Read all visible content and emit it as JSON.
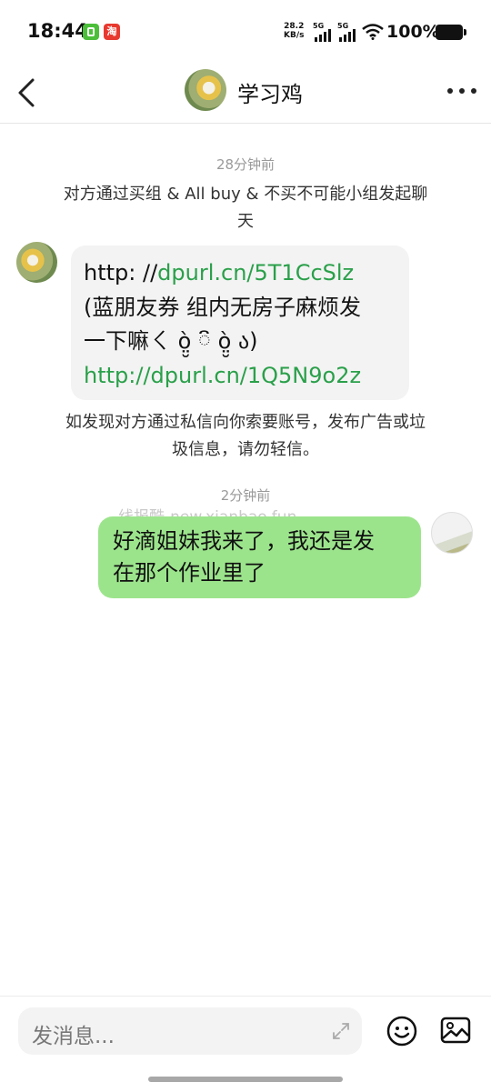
{
  "status_bar": {
    "time": "18:44",
    "notification_badge": "淘",
    "net_speed_value": "28.2",
    "net_speed_unit": "KB/s",
    "signal_1": "5G",
    "signal_2": "5G",
    "battery": "100%"
  },
  "header": {
    "title": "学习鸡",
    "back_icon": "chevron-left-icon",
    "more_icon": "more-horizontal-icon"
  },
  "chat": {
    "timestamp_1": "28分钟前",
    "system_intro_line1": "对方通过买组 & All buy & 不买不可能小组发起聊",
    "system_intro_line2": "天",
    "incoming_message": {
      "line1_prefix": "http: //",
      "line1_link": "dpurl.cn/5T1CcSlz",
      "line2": "(蓝朋友券 组内无房子麻烦发",
      "line3": "一下嘛ㄑ ὸ̤̮ ៝ ὸ̤̮ ა)",
      "line4_link": "http://dpurl.cn/1Q5N9o2z"
    },
    "system_warning_line1": "如发现对方通过私信向你索要账号，发布广告或垃",
    "system_warning_line2": "圾信息，请勿轻信。",
    "timestamp_2": "2分钟前",
    "watermark": "线报酷-new.xianbao.fun",
    "outgoing_message": {
      "line1": "好滴姐妹我来了，我还是发",
      "line2": "在那个作业里了"
    }
  },
  "input_bar": {
    "placeholder": "发消息...",
    "expand_icon": "expand-icon",
    "emoji_icon": "smiley-icon",
    "image_icon": "image-icon"
  },
  "colors": {
    "outgoing_bubble": "#9ce48c",
    "incoming_bubble": "#f3f3f3",
    "link": "#2aa04a"
  }
}
